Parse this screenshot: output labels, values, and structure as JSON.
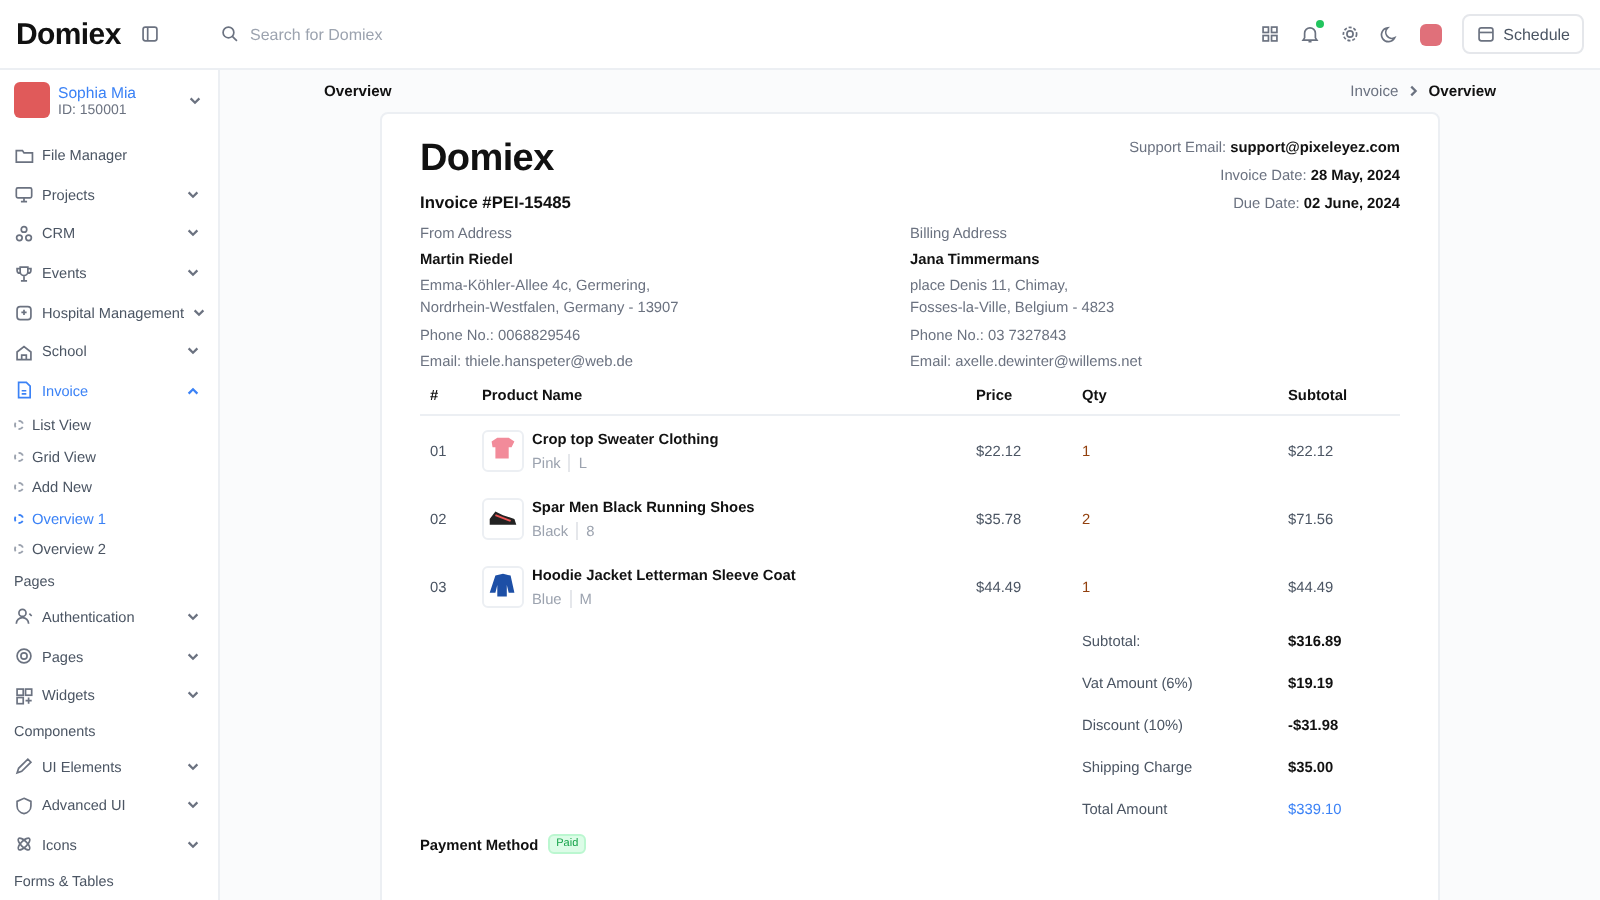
{
  "topbar": {
    "logo": "Domiex",
    "search": {
      "placeholder": "Search for Domiex"
    },
    "notification_dot": true,
    "schedule_button": "Schedule"
  },
  "user": {
    "name": "Sophia Mia",
    "id": "ID: 150001"
  },
  "sidebar": {
    "items": [
      {
        "kind": "link",
        "label": "File Manager",
        "selected": false
      },
      {
        "kind": "menu",
        "label": "Projects",
        "selected": false,
        "expanded": false
      },
      {
        "kind": "menu",
        "label": "CRM",
        "selected": false,
        "expanded": false
      },
      {
        "kind": "menu",
        "label": "Events",
        "selected": false,
        "expanded": false
      },
      {
        "kind": "menu",
        "label": "Hospital Management",
        "selected": false,
        "expanded": false
      },
      {
        "kind": "menu",
        "label": "School",
        "selected": false,
        "expanded": false
      },
      {
        "kind": "menu",
        "label": "Invoice",
        "selected": true,
        "expanded": true,
        "children": [
          {
            "label": "List View",
            "selected": false
          },
          {
            "label": "Grid View",
            "selected": false
          },
          {
            "label": "Add New",
            "selected": false
          },
          {
            "label": "Overview 1",
            "selected": true
          },
          {
            "label": "Overview 2",
            "selected": false
          }
        ]
      },
      {
        "kind": "section",
        "label": "Pages"
      },
      {
        "kind": "menu",
        "label": "Authentication",
        "selected": false,
        "expanded": false
      },
      {
        "kind": "menu",
        "label": "Pages",
        "selected": false,
        "expanded": false
      },
      {
        "kind": "menu",
        "label": "Widgets",
        "selected": false,
        "expanded": false
      },
      {
        "kind": "section",
        "label": "Components"
      },
      {
        "kind": "menu",
        "label": "UI Elements",
        "selected": false,
        "expanded": false
      },
      {
        "kind": "menu",
        "label": "Advanced UI",
        "selected": false,
        "expanded": false
      },
      {
        "kind": "menu",
        "label": "Icons",
        "selected": false,
        "expanded": false
      },
      {
        "kind": "section",
        "label": "Forms & Tables"
      }
    ]
  },
  "page_title": "Overview",
  "breadcrumb": [
    "Invoice",
    "Overview"
  ],
  "invoice": {
    "logo": "Domiex",
    "number": "Invoice #PEI-15485",
    "meta": [
      {
        "label": "Support Email:",
        "value": "support@pixeleyez.com"
      },
      {
        "label": "Invoice Date:",
        "value": "28 May, 2024"
      },
      {
        "label": "Due Date:",
        "value": "02 June, 2024"
      }
    ],
    "addresses": [
      {
        "heading": "From Address",
        "name": "Martin Riedel",
        "address": [
          "Emma-Köhler-Allee 4c, Germering,",
          "Nordrhein-Westfalen, Germany - 13907"
        ],
        "phone": "Phone No.: 0068829546",
        "email": "Email: thiele.hanspeter@web.de"
      },
      {
        "heading": "Billing Address",
        "name": "Jana Timmermans",
        "address": [
          "place Denis 11, Chimay,",
          "Fosses-la-Ville, Belgium - 4823"
        ],
        "phone": "Phone No.: 03 7327843",
        "email": "Email: axelle.dewinter@willems.net"
      }
    ],
    "columns": [
      "#",
      "Product Name",
      "Price",
      "Qty",
      "Subtotal"
    ],
    "rows": [
      {
        "no": "01",
        "name": "Crop top Sweater Clothing",
        "variant": "Pink",
        "size": "L",
        "price": "$22.12",
        "qty": "1",
        "subtotal": "$22.12"
      },
      {
        "no": "02",
        "name": "Spar Men Black Running Shoes",
        "variant": "Black",
        "size": "8",
        "price": "$35.78",
        "qty": "2",
        "subtotal": "$71.56"
      },
      {
        "no": "03",
        "name": "Hoodie Jacket Letterman Sleeve Coat",
        "variant": "Blue",
        "size": "M",
        "price": "$44.49",
        "qty": "1",
        "subtotal": "$44.49"
      }
    ],
    "totals": [
      {
        "label": "Subtotal:",
        "value": "$316.89",
        "highlight": false
      },
      {
        "label": "Vat Amount (6%)",
        "value": "$19.19",
        "highlight": false
      },
      {
        "label": "Discount (10%)",
        "value": "-$31.98",
        "highlight": false
      },
      {
        "label": "Shipping Charge",
        "value": "$35.00",
        "highlight": false
      },
      {
        "label": "Total Amount",
        "value": "$339.10",
        "highlight": true
      }
    ],
    "payment": {
      "label": "Payment Method",
      "status": "Paid"
    }
  }
}
